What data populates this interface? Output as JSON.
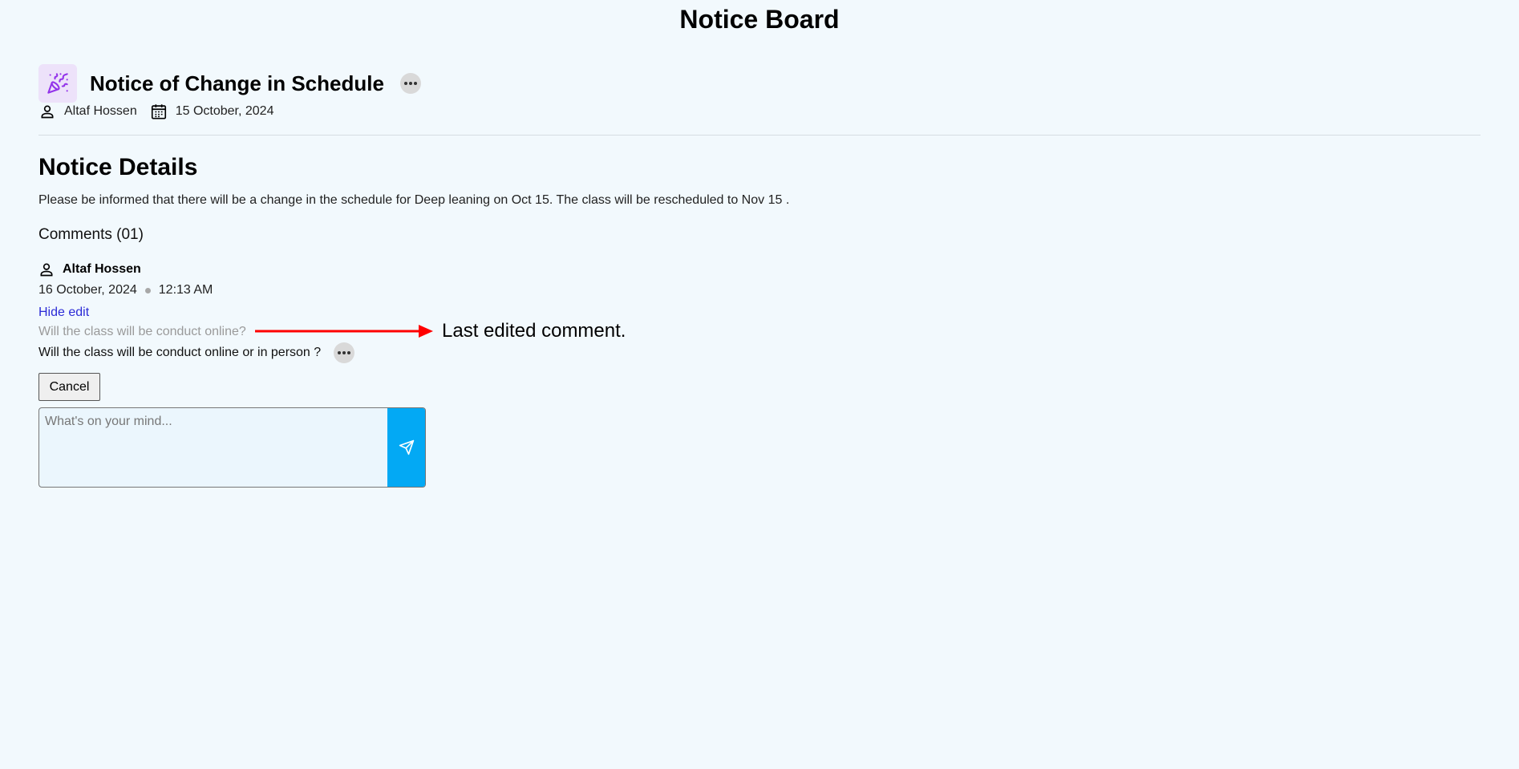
{
  "page": {
    "title": "Notice Board"
  },
  "notice": {
    "icon": "party-popper-icon",
    "title": "Notice of Change in Schedule",
    "more_icon": "ellipsis-icon",
    "author": "Altaf Hossen",
    "date": "15 October, 2024"
  },
  "details": {
    "heading": "Notice Details",
    "body": "Please be informed that there will be a change in the schedule for Deep leaning on Oct 15. The class will be rescheduled to Nov 15 ."
  },
  "comments": {
    "heading": "Comments (01)",
    "items": [
      {
        "author": "Altaf Hossen",
        "date": "16 October, 2024",
        "time": "12:13 AM",
        "hide_edit_label": "Hide edit",
        "previous_text": "Will the class will be conduct online?",
        "text": "Will the class will be conduct online or in person ?"
      }
    ]
  },
  "annotation": {
    "text": "Last edited comment.",
    "color": "#ff0000"
  },
  "actions": {
    "cancel_label": "Cancel"
  },
  "composer": {
    "placeholder": "What's on your mind...",
    "send_icon": "send-icon",
    "send_color": "#03a9f4"
  },
  "colors": {
    "background": "#f2f9fd",
    "link": "#2b2bd6",
    "icon_accent": "#9333ea"
  }
}
